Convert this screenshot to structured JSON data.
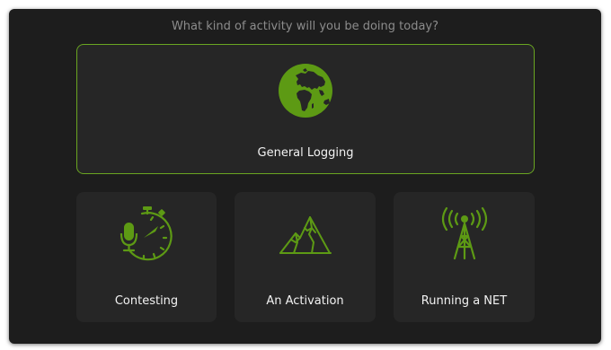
{
  "prompt": "What kind of activity will you be doing today?",
  "accent_color": "#5d9a14",
  "options": [
    {
      "label": "General Logging",
      "icon": "globe-icon",
      "selected": true
    },
    {
      "label": "Contesting",
      "icon": "stopwatch-microphone-icon",
      "selected": false
    },
    {
      "label": "An Activation",
      "icon": "mountain-icon",
      "selected": false
    },
    {
      "label": "Running a NET",
      "icon": "radio-tower-icon",
      "selected": false
    }
  ]
}
